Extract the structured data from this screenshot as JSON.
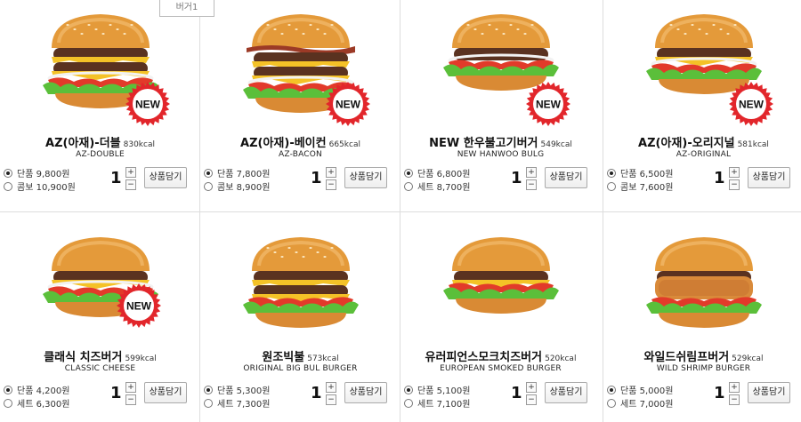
{
  "tab": {
    "label": "버거1"
  },
  "products": [
    {
      "name": "AZ(아재)-더블",
      "kcal": "830kcal",
      "en": "AZ-DOUBLE",
      "is_new": true,
      "badge": "NEW",
      "options": [
        {
          "label": "단품",
          "price": "9,800원",
          "selected": true
        },
        {
          "label": "콤보",
          "price": "10,900원",
          "selected": false
        }
      ],
      "qty": "1",
      "cart_label": "상품담기",
      "inc": "+",
      "dec": "−"
    },
    {
      "name": "AZ(아재)-베이컨",
      "kcal": "665kcal",
      "en": "AZ-BACON",
      "is_new": true,
      "badge": "NEW",
      "options": [
        {
          "label": "단품",
          "price": "7,800원",
          "selected": true
        },
        {
          "label": "콤보",
          "price": "8,900원",
          "selected": false
        }
      ],
      "qty": "1",
      "cart_label": "상품담기",
      "inc": "+",
      "dec": "−"
    },
    {
      "name": "NEW 한우불고기버거",
      "kcal": "549kcal",
      "en": "NEW HANWOO BULG",
      "is_new": true,
      "badge": "NEW",
      "options": [
        {
          "label": "단품",
          "price": "6,800원",
          "selected": true
        },
        {
          "label": "세트",
          "price": "8,700원",
          "selected": false
        }
      ],
      "qty": "1",
      "cart_label": "상품담기",
      "inc": "+",
      "dec": "−"
    },
    {
      "name": "AZ(아재)-오리지널",
      "kcal": "581kcal",
      "en": "AZ-ORIGINAL",
      "is_new": true,
      "badge": "NEW",
      "options": [
        {
          "label": "단품",
          "price": "6,500원",
          "selected": true
        },
        {
          "label": "콤보",
          "price": "7,600원",
          "selected": false
        }
      ],
      "qty": "1",
      "cart_label": "상품담기",
      "inc": "+",
      "dec": "−"
    },
    {
      "name": "클래식 치즈버거",
      "kcal": "599kcal",
      "en": "CLASSIC CHEESE",
      "is_new": true,
      "badge": "NEW",
      "options": [
        {
          "label": "단품",
          "price": "4,200원",
          "selected": true
        },
        {
          "label": "세트",
          "price": "6,300원",
          "selected": false
        }
      ],
      "qty": "1",
      "cart_label": "상품담기",
      "inc": "+",
      "dec": "−"
    },
    {
      "name": "원조빅불",
      "kcal": "573kcal",
      "en": "ORIGINAL BIG BUL BURGER",
      "is_new": false,
      "badge": "",
      "options": [
        {
          "label": "단품",
          "price": "5,300원",
          "selected": true
        },
        {
          "label": "세트",
          "price": "7,300원",
          "selected": false
        }
      ],
      "qty": "1",
      "cart_label": "상품담기",
      "inc": "+",
      "dec": "−"
    },
    {
      "name": "유러피언스모크치즈버거",
      "kcal": "520kcal",
      "en": "EUROPEAN SMOKED BURGER",
      "is_new": false,
      "badge": "",
      "options": [
        {
          "label": "단품",
          "price": "5,100원",
          "selected": true
        },
        {
          "label": "세트",
          "price": "7,100원",
          "selected": false
        }
      ],
      "qty": "1",
      "cart_label": "상품담기",
      "inc": "+",
      "dec": "−"
    },
    {
      "name": "와일드쉬림프버거",
      "kcal": "529kcal",
      "en": "WILD SHRIMP BURGER",
      "is_new": false,
      "badge": "",
      "options": [
        {
          "label": "단품",
          "price": "5,000원",
          "selected": true
        },
        {
          "label": "세트",
          "price": "7,000원",
          "selected": false
        }
      ],
      "qty": "1",
      "cart_label": "상품담기",
      "inc": "+",
      "dec": "−"
    }
  ],
  "colors": {
    "bun": "#e49a3a",
    "patty": "#5a3220",
    "cheese": "#f4c227",
    "lettuce": "#5bbf3a",
    "tomato": "#e23a2a",
    "badge_red": "#e2262b"
  }
}
